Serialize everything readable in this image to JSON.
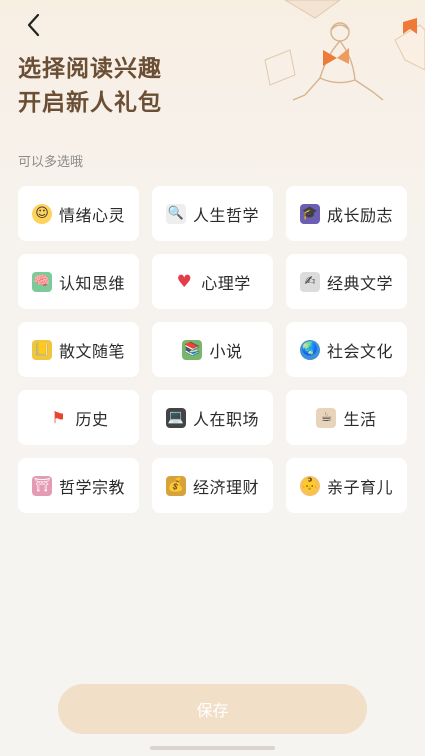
{
  "header": {
    "back_icon": "chevron-left-icon",
    "title_line1": "选择阅读兴趣",
    "title_line2": "开启新人礼包"
  },
  "hint": "可以多选哦",
  "categories": [
    {
      "label": "情绪心灵",
      "icon": "smiling-face-icon",
      "color": "#ffd25a"
    },
    {
      "label": "人生哲学",
      "icon": "magnifier-icon",
      "color": "#e8e8e8"
    },
    {
      "label": "成长励志",
      "icon": "graduation-cap-icon",
      "color": "#6b5fb3"
    },
    {
      "label": "认知思维",
      "icon": "brain-icon",
      "color": "#7cc99a"
    },
    {
      "label": "心理学",
      "icon": "heart-icon",
      "color": "#e33d4a"
    },
    {
      "label": "经典文学",
      "icon": "writing-hand-icon",
      "color": "#d8d8d8"
    },
    {
      "label": "散文随笔",
      "icon": "notebook-icon",
      "color": "#f2c63c"
    },
    {
      "label": "小说",
      "icon": "book-stack-icon",
      "color": "#79b56b"
    },
    {
      "label": "社会文化",
      "icon": "globe-icon",
      "color": "#3f8fd9"
    },
    {
      "label": "历史",
      "icon": "flag-icon",
      "color": "#f3a62d"
    },
    {
      "label": "人在职场",
      "icon": "laptop-icon",
      "color": "#444444"
    },
    {
      "label": "生活",
      "icon": "coffee-cup-icon",
      "color": "#c9a57a"
    },
    {
      "label": "哲学宗教",
      "icon": "temple-icon",
      "color": "#e49bb3"
    },
    {
      "label": "经济理财",
      "icon": "money-bag-icon",
      "color": "#d6a23e"
    },
    {
      "label": "亲子育儿",
      "icon": "child-face-icon",
      "color": "#f6c15a"
    }
  ],
  "footer": {
    "save_label": "保存"
  }
}
